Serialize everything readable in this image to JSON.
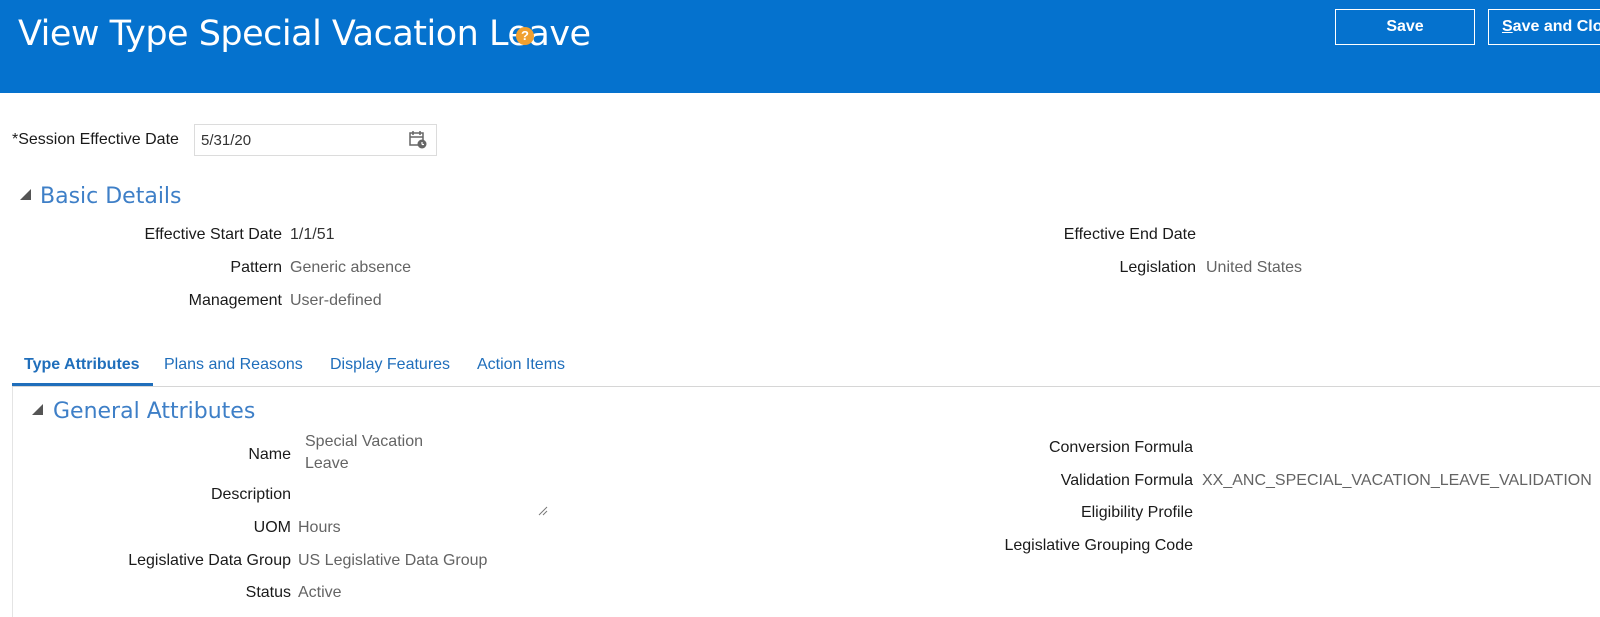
{
  "header": {
    "title": "View Type Special Vacation Leave",
    "help_icon": "question-mark-icon",
    "save_label": "Save",
    "save_close_accel": "S",
    "save_close_rest": "ave and Close",
    "bg_color": "#0572ce"
  },
  "session": {
    "required_mark": "*",
    "label": "Session Effective Date",
    "value": "5/31/20",
    "calendar_icon": "calendar-icon"
  },
  "basic_details": {
    "title": "Basic Details",
    "effective_start_date_label": "Effective Start Date",
    "effective_start_date_value": "1/1/51",
    "pattern_label": "Pattern",
    "pattern_value": "Generic absence",
    "management_label": "Management",
    "management_value": "User-defined",
    "effective_end_date_label": "Effective End Date",
    "effective_end_date_value": "",
    "legislation_label": "Legislation",
    "legislation_value": "United States"
  },
  "tabs": [
    {
      "label": "Type Attributes",
      "active": true
    },
    {
      "label": "Plans and Reasons",
      "active": false
    },
    {
      "label": "Display Features",
      "active": false
    },
    {
      "label": "Action Items",
      "active": false
    }
  ],
  "general_attributes": {
    "title": "General Attributes",
    "name_label": "Name",
    "name_value_line1": "Special Vacation",
    "name_value_line2": "Leave",
    "description_label": "Description",
    "description_value": "",
    "uom_label": "UOM",
    "uom_value": "Hours",
    "ldg_label": "Legislative Data Group",
    "ldg_value": "US Legislative Data Group",
    "status_label": "Status",
    "status_value": "Active",
    "conversion_formula_label": "Conversion Formula",
    "conversion_formula_value": "",
    "validation_formula_label": "Validation Formula",
    "validation_formula_value": "XX_ANC_SPECIAL_VACATION_LEAVE_VALIDATION",
    "eligibility_profile_label": "Eligibility Profile",
    "eligibility_profile_value": "",
    "legislative_grouping_code_label": "Legislative Grouping Code",
    "legislative_grouping_code_value": ""
  }
}
